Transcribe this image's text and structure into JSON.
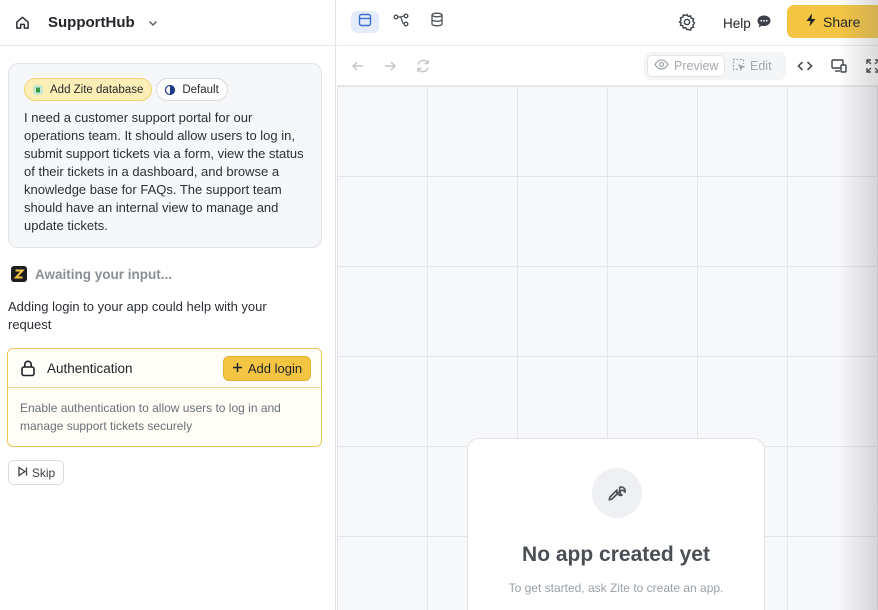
{
  "left": {
    "app_name": "SupportHub",
    "chips": {
      "database": "Add Zite database",
      "default": "Default"
    },
    "prompt": "I need a customer support portal for our operations team. It should allow users to log in, submit support tickets via a form, view the status of their tickets in a dashboard, and browse a knowledge base for FAQs. The support team should have an internal view to manage and update tickets.",
    "status": "Awaiting your input...",
    "suggestion": "Adding login to your app could help with your request",
    "auth": {
      "title": "Authentication",
      "button": "Add login",
      "description": "Enable authentication to allow users to log in and manage support tickets securely"
    },
    "skip": "Skip"
  },
  "topbar": {
    "help": "Help",
    "share": "Share"
  },
  "toolbar": {
    "preview": "Preview",
    "edit": "Edit"
  },
  "empty": {
    "title": "No app created yet",
    "subtitle": "To get started, ask Zite to create an app."
  },
  "colors": {
    "accent_yellow": "#f4c542",
    "active_view_bg": "#e4ecfb",
    "active_view_icon": "#3b6fd6"
  }
}
